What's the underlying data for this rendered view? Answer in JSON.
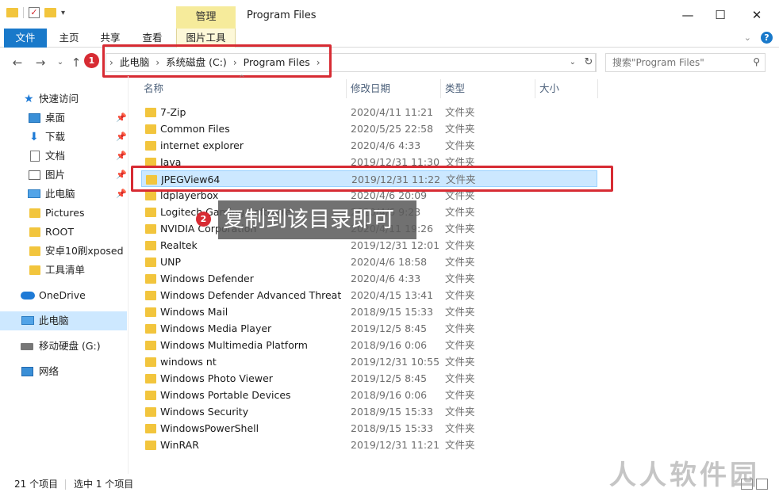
{
  "window": {
    "title": "Program Files",
    "manage_tab": "管理",
    "controls": {
      "minimize": "—",
      "maximize": "☐",
      "close": "✕"
    }
  },
  "ribbon": {
    "tabs": [
      "文件",
      "主页",
      "共享",
      "查看",
      "图片工具"
    ]
  },
  "address": {
    "crumbs": [
      "此电脑",
      "系统磁盘 (C:)",
      "Program Files"
    ],
    "search_placeholder": "搜索\"Program Files\""
  },
  "annotations": {
    "badge1": "1",
    "badge2": "2",
    "caption": "复制到该目录即可",
    "colors": {
      "red": "#d72b33"
    }
  },
  "nav": {
    "items": [
      {
        "label": "快速访问",
        "icon": "star-icon"
      },
      {
        "label": "桌面",
        "icon": "desktop-icon",
        "pinned": true
      },
      {
        "label": "下载",
        "icon": "download-icon",
        "pinned": true
      },
      {
        "label": "文档",
        "icon": "document-icon",
        "pinned": true
      },
      {
        "label": "图片",
        "icon": "picture-icon",
        "pinned": true
      },
      {
        "label": "此电脑",
        "icon": "computer-icon",
        "pinned": true
      },
      {
        "label": "Pictures",
        "icon": "folder-icon"
      },
      {
        "label": "ROOT",
        "icon": "folder-icon"
      },
      {
        "label": "安卓10刷xposed",
        "icon": "folder-icon"
      },
      {
        "label": "工具清单",
        "icon": "folder-icon"
      },
      {
        "label": "OneDrive",
        "icon": "onedrive-icon"
      },
      {
        "label": "此电脑",
        "icon": "computer-icon",
        "selected": true
      },
      {
        "label": "移动硬盘 (G:)",
        "icon": "drive-icon"
      },
      {
        "label": "网络",
        "icon": "network-icon"
      }
    ]
  },
  "columns": [
    "名称",
    "修改日期",
    "类型",
    "大小"
  ],
  "files": [
    {
      "name": "7-Zip",
      "date": "2020/4/11 11:21",
      "type": "文件夹"
    },
    {
      "name": "Common Files",
      "date": "2020/5/25 22:58",
      "type": "文件夹"
    },
    {
      "name": "internet explorer",
      "date": "2020/4/6 4:33",
      "type": "文件夹"
    },
    {
      "name": "Java",
      "date": "2019/12/31 11:30",
      "type": "文件夹"
    },
    {
      "name": "JPEGView64",
      "date": "2019/12/31 11:22",
      "type": "文件夹",
      "selected": true
    },
    {
      "name": "ldplayerbox",
      "date": "2020/4/6 20:09",
      "type": "文件夹"
    },
    {
      "name": "Logitech Gaming Software",
      "date": "2020/4/6 9:23",
      "type": "文件夹"
    },
    {
      "name": "NVIDIA Corporation",
      "date": "2020/4/11 19:26",
      "type": "文件夹"
    },
    {
      "name": "Realtek",
      "date": "2019/12/31 12:01",
      "type": "文件夹"
    },
    {
      "name": "UNP",
      "date": "2020/4/6 18:58",
      "type": "文件夹"
    },
    {
      "name": "Windows Defender",
      "date": "2020/4/6 4:33",
      "type": "文件夹"
    },
    {
      "name": "Windows Defender Advanced Threat ...",
      "date": "2020/4/15 13:41",
      "type": "文件夹"
    },
    {
      "name": "Windows Mail",
      "date": "2018/9/15 15:33",
      "type": "文件夹"
    },
    {
      "name": "Windows Media Player",
      "date": "2019/12/5 8:45",
      "type": "文件夹"
    },
    {
      "name": "Windows Multimedia Platform",
      "date": "2018/9/16 0:06",
      "type": "文件夹"
    },
    {
      "name": "windows nt",
      "date": "2019/12/31 10:55",
      "type": "文件夹"
    },
    {
      "name": "Windows Photo Viewer",
      "date": "2019/12/5 8:45",
      "type": "文件夹"
    },
    {
      "name": "Windows Portable Devices",
      "date": "2018/9/16 0:06",
      "type": "文件夹"
    },
    {
      "name": "Windows Security",
      "date": "2018/9/15 15:33",
      "type": "文件夹"
    },
    {
      "name": "WindowsPowerShell",
      "date": "2018/9/15 15:33",
      "type": "文件夹"
    },
    {
      "name": "WinRAR",
      "date": "2019/12/31 11:21",
      "type": "文件夹"
    }
  ],
  "status": {
    "count": "21 个项目",
    "selected": "选中 1 个项目"
  },
  "watermark": "人人软件园"
}
